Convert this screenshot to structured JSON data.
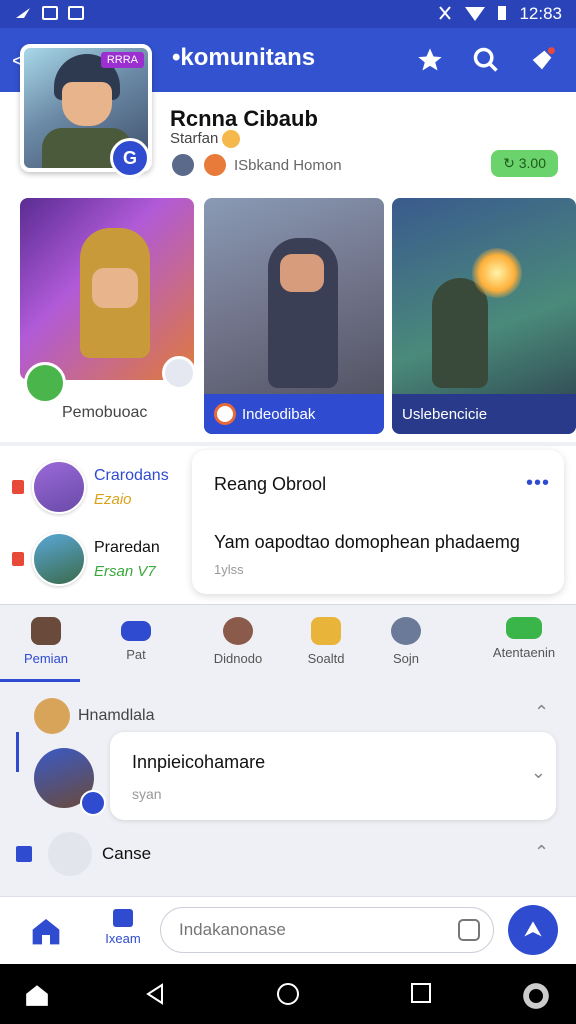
{
  "status": {
    "time": "12:83"
  },
  "appbar": {
    "back": "<",
    "title": "•komunitans"
  },
  "profile": {
    "avatar_tag": "RRRA",
    "badge": "G",
    "name": "Rcnna Cibaub",
    "subtitle": "Starfan",
    "members": "ISbkand Homon",
    "coins": "↻ 3.00"
  },
  "cards": [
    {
      "label": "Pemobuoac"
    },
    {
      "label": "Indeodibak"
    },
    {
      "label": "Uslebencicie"
    }
  ],
  "chats": [
    {
      "name": "Crarodans",
      "sub": "Ezaio"
    },
    {
      "name": "Praredan",
      "sub": "Ersan V7"
    }
  ],
  "bubble": {
    "title": "Reang Obrool",
    "more": "•••",
    "body": "Yam oapodtao domophean phadaemg",
    "time": "1ylss"
  },
  "tabs": [
    {
      "label": "Pemian",
      "icon": "helmet-icon"
    },
    {
      "label": "Pat",
      "icon": "tv-icon"
    },
    {
      "label": "Didnodo",
      "icon": "avatar-icon"
    },
    {
      "label": "Soaltd",
      "icon": "star-icon"
    },
    {
      "label": "Sojn",
      "icon": "person-icon"
    },
    {
      "label": "Atentaenin",
      "icon": "chat-icon"
    }
  ],
  "thread": {
    "header": "Hnamdlala",
    "message": "Innpieicohamare",
    "sub": "syan",
    "section": "Canse"
  },
  "composer": {
    "tab_label": "Ixeam",
    "placeholder": "Indakanonase"
  },
  "colors": {
    "primary": "#2f4bd0",
    "appbar": "#3352cf",
    "coins": "#6bd36b"
  }
}
